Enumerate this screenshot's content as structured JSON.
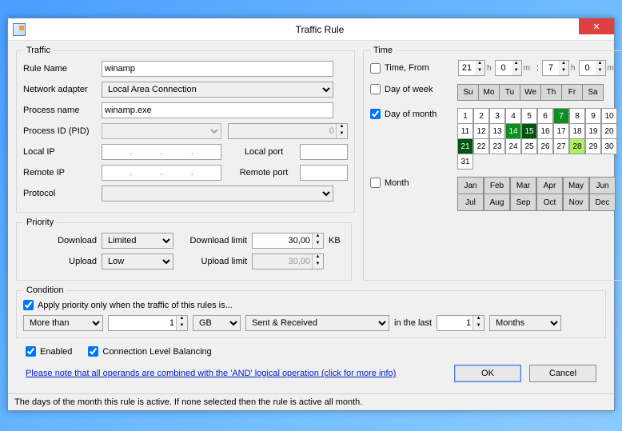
{
  "window": {
    "title": "Traffic Rule"
  },
  "traffic": {
    "legend": "Traffic",
    "rule_name_label": "Rule Name",
    "rule_name": "winamp",
    "adapter_label": "Network adapter",
    "adapter": "Local Area Connection",
    "process_name_label": "Process name",
    "process_name": "winamp.exe",
    "pid_label": "Process ID (PID)",
    "pid_select": "",
    "pid_value": "0",
    "local_ip_label": "Local IP",
    "local_port_label": "Local port",
    "local_port": "",
    "remote_ip_label": "Remote IP",
    "remote_port_label": "Remote port",
    "remote_port": "",
    "protocol_label": "Protocol",
    "protocol": ""
  },
  "priority": {
    "legend": "Priority",
    "download_label": "Download",
    "download": "Limited",
    "upload_label": "Upload",
    "upload": "Low",
    "dl_limit_label": "Download limit",
    "dl_limit": "30,00",
    "ul_limit_label": "Upload limit",
    "ul_limit": "30,00",
    "unit": "KB"
  },
  "time": {
    "legend": "Time",
    "from_label": "Time, From",
    "from_h": "21",
    "from_m": "0",
    "to_h": "7",
    "to_m": "0",
    "h": "h",
    "m": "m",
    "dow_label": "Day of week",
    "dow": [
      "Su",
      "Mo",
      "Tu",
      "We",
      "Th",
      "Fr",
      "Sa"
    ],
    "dom_label": "Day of month",
    "dom_days": [
      "1",
      "2",
      "3",
      "4",
      "5",
      "6",
      "7",
      "8",
      "9",
      "10",
      "11",
      "12",
      "13",
      "14",
      "15",
      "16",
      "17",
      "18",
      "19",
      "20",
      "21",
      "22",
      "23",
      "24",
      "25",
      "26",
      "27",
      "28",
      "29",
      "30",
      "31"
    ],
    "dom_selected_green": [
      "7",
      "14"
    ],
    "dom_selected_dark": [
      "15",
      "21"
    ],
    "dom_selected_light": [
      "28"
    ],
    "month_label": "Month",
    "months": [
      "Jan",
      "Feb",
      "Mar",
      "Apr",
      "May",
      "Jun",
      "Jul",
      "Aug",
      "Sep",
      "Oct",
      "Nov",
      "Dec"
    ]
  },
  "condition": {
    "legend": "Condition",
    "apply_label": "Apply priority only when the traffic of this rules is...",
    "op": "More than",
    "value": "1",
    "unit": "GB",
    "direction": "Sent & Received",
    "in_last": "in the last",
    "period_n": "1",
    "period": "Months"
  },
  "bottom": {
    "enabled_label": "Enabled",
    "clb_label": "Connection Level Balancing"
  },
  "footer": {
    "note": "Please note that all operands are combined with the 'AND' logical operation (click for more info)",
    "ok": "OK",
    "cancel": "Cancel"
  },
  "status": "The days of the month this rule is active. If none selected then the rule is active all month."
}
